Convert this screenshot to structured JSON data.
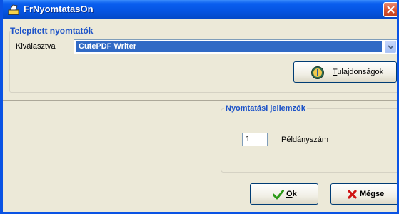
{
  "window": {
    "title": "FrNyomtatasOn",
    "icon": "printer-app-icon",
    "close_icon": "close-icon"
  },
  "printers_section": {
    "title": "Telepített nyomtatók",
    "selected_label": "Kiválasztva",
    "selected_value": "CutePDF Writer",
    "dropdown_icon": "chevron-down-icon",
    "properties_button": {
      "label_access_key": "T",
      "label_rest": "ulajdonságok",
      "icon": "properties-icon"
    }
  },
  "print_settings": {
    "title": "Nyomtatási jellemzők",
    "copies_value": "1",
    "copies_label": "Példányszám"
  },
  "actions": {
    "ok": {
      "access_key": "O",
      "rest": "k",
      "icon": "checkmark-icon"
    },
    "cancel": {
      "label": "Mégse",
      "icon": "red-x-icon"
    }
  },
  "colors": {
    "titlebar": "#0555e3",
    "selection": "#316ac5",
    "section_title": "#1d53c8",
    "dialog_bg": "#ece9d8"
  }
}
